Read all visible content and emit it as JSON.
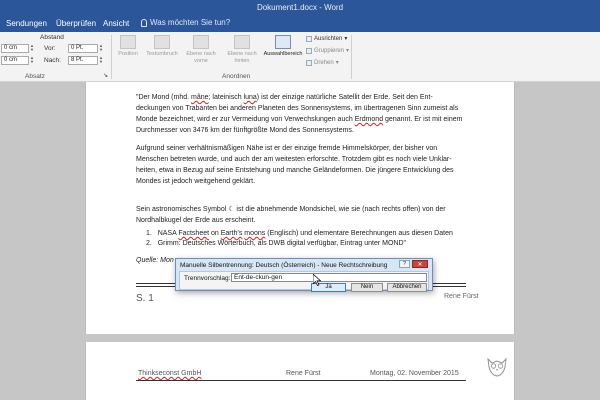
{
  "window": {
    "title": "Dokument1.docx - Word"
  },
  "tabs": [
    "Sendungen",
    "Überprüfen",
    "Ansicht"
  ],
  "tell_me": "Was möchten Sie tun?",
  "ribbon": {
    "absatz": {
      "header": "Abstand",
      "left_before": "0 cm",
      "left_after": "0 cm",
      "vor_label": "Vor:",
      "vor_value": "0 Pt.",
      "nach_label": "Nach:",
      "nach_value": "8 Pt.",
      "group_label": "Absatz"
    },
    "anordnen": {
      "position": "Position",
      "textumbruch": "Textumbruch",
      "ebene_vor_1": "Ebene nach",
      "ebene_vor_2": "vorne",
      "ebene_hinten_1": "Ebene nach",
      "ebene_hinten_2": "hinten",
      "auswahlbereich": "Auswahlbereich",
      "ausrichten": "Ausrichten",
      "gruppieren": "Gruppieren",
      "drehen": "Drehen",
      "group_label": "Anordnen"
    }
  },
  "document": {
    "p1": {
      "a": "\"Der Mond (mhd. ",
      "mane": "mâne",
      "b": "; lateinisch ",
      "luna": "luna",
      "c": ") ist der einzige natürliche Satellit der Erde. Seit den Ent- deckungen von Trabanten bei anderen Planeten des Sonnensystems, im übertragenen Sinn zumeist als Monde bezeichnet, wird er zur Vermeidung von Verwechslungen auch ",
      "erdmond": "Erdmond",
      "d": " genannt. Er ist mit einem Durchmesser von 3476 km der fünftgrößte Mond des Sonnensystems."
    },
    "p2": "Aufgrund seiner verhältnismäßigen Nähe ist er der einzige fremde Himmelskörper, der bisher von Menschen betreten wurde, und auch der am weitesten erforschte. Trotzdem gibt es noch viele Unklar- heiten, etwa in Bezug auf seine Entstehung und manche Geländeformen. Die jüngere Entwicklung des Mondes ist jedoch weitgehend geklärt.",
    "p3": "Sein astronomisches Symbol ☾ ist die abnehmende Mondsichel, wie sie (nach rechts offen) von der Nordhalbkugel der Erde aus erscheint.",
    "list": {
      "i1_num": "1.",
      "i1_a": "NASA ",
      "i1_factsheet": "Factsheet",
      "i1_b": " on ",
      "i1_earths": "Earth's",
      "i1_c": " ",
      "i1_moons": "moons",
      "i1_d": " (Englisch) und elementare Berechnungen aus diesen Daten",
      "i2_num": "2.",
      "i2": "Grimm: Deutsches Wörterbuch, als DWB digital verfügbar, Eintrag unter MOND\""
    },
    "quelle": "Quelle: Mon",
    "footer_section": "S. 1",
    "footer_author": "Rene Fürst",
    "header2_company": "Thinkseconst GmbH",
    "header2_author": "Rene Fürst",
    "header2_date": "Montag, 02. November 2015"
  },
  "dialog": {
    "title": "Manuelle Silbentrennung: Deutsch (Österreich) - Neue Rechtschreibung",
    "help": "?",
    "close": "✕",
    "label": "Trennvorschlag:",
    "value": "Ent-de-ckun-gen",
    "ja": "Ja",
    "nein": "Nein",
    "abbrechen": "Abbrechen"
  }
}
